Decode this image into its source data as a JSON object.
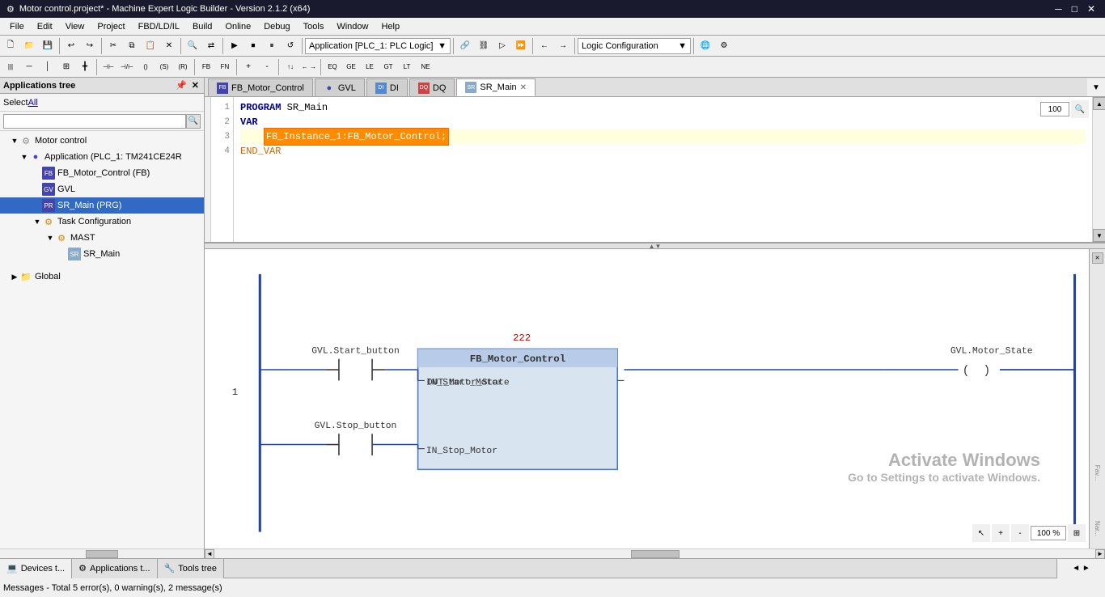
{
  "window": {
    "title": "Motor control.project* - Machine Expert Logic Builder - Version 2.1.2 (x64)"
  },
  "titlebar": {
    "title": "Motor control.project* - Machine Expert Logic Builder - Version 2.1.2 (x64)",
    "minimize": "─",
    "restore": "□",
    "close": "✕"
  },
  "menu": {
    "items": [
      "File",
      "Edit",
      "View",
      "Project",
      "FBD/LD/IL",
      "Build",
      "Online",
      "Debug",
      "Tools",
      "Window",
      "Help"
    ]
  },
  "apps_tree": {
    "header": "Applications tree",
    "select_all": "Select All",
    "tree_items": [
      {
        "label": "Motor control",
        "level": 0,
        "expanded": true,
        "icon": "gear"
      },
      {
        "label": "Application (PLC_1: TM241CE24R",
        "level": 1,
        "expanded": true,
        "icon": "app"
      },
      {
        "label": "FB_Motor_Control (FB)",
        "level": 2,
        "expanded": false,
        "icon": "fb"
      },
      {
        "label": "GVL",
        "level": 2,
        "expanded": false,
        "icon": "gvl"
      },
      {
        "label": "SR_Main (PRG)",
        "level": 2,
        "expanded": false,
        "icon": "prg",
        "selected": true
      },
      {
        "label": "Task Configuration",
        "level": 2,
        "expanded": true,
        "icon": "task"
      },
      {
        "label": "MAST",
        "level": 3,
        "expanded": true,
        "icon": "mast"
      },
      {
        "label": "SR_Main",
        "level": 4,
        "expanded": false,
        "icon": "sr"
      }
    ],
    "global_items": [
      {
        "label": "Global",
        "level": 0,
        "expanded": false,
        "icon": "global"
      }
    ]
  },
  "tabs": [
    {
      "label": "FB_Motor_Control",
      "icon": "fb",
      "active": false,
      "closable": false
    },
    {
      "label": "GVL",
      "icon": "gvl",
      "active": false,
      "closable": false
    },
    {
      "label": "DI",
      "icon": "di",
      "active": false,
      "closable": false
    },
    {
      "label": "DQ",
      "icon": "dq",
      "active": false,
      "closable": false
    },
    {
      "label": "SR_Main",
      "icon": "sr",
      "active": true,
      "closable": true
    }
  ],
  "code": {
    "lines": [
      {
        "num": "1",
        "content": "PROGRAM SR_Main",
        "type": "normal"
      },
      {
        "num": "2",
        "content": "VAR",
        "type": "keyword"
      },
      {
        "num": "3",
        "content": "    FB_Instance_1:FB_Motor_Control;",
        "type": "highlight"
      },
      {
        "num": "4",
        "content": "END_VAR",
        "type": "keyword"
      }
    ],
    "zoom": "100"
  },
  "diagram": {
    "rung_number": "1",
    "error_label": "222",
    "elements": {
      "start_button": {
        "label": "GVL.Start_button",
        "contact_type": "NO"
      },
      "stop_button": {
        "label": "GVL.Stop_button",
        "contact_type": "NO"
      },
      "fb_block": {
        "name": "FB_Motor_Control",
        "input1": "IN_Start_Motor",
        "output1": "OUT_Motor_State",
        "input2": "IN_Stop_Motor"
      },
      "motor_state": {
        "label": "GVL.Motor_State",
        "coil_type": "normal"
      }
    },
    "zoom": "100 %"
  },
  "toolbar_dropdown": {
    "value": "Application [PLC_1: PLC Logic]"
  },
  "toolbar_right_dropdown": {
    "value": "Logic Configuration"
  },
  "bottom": {
    "tabs": [
      {
        "label": "Devices t...",
        "icon": "device"
      },
      {
        "label": "Applications t...",
        "icon": "app"
      },
      {
        "label": "Tools tree",
        "icon": "tools"
      }
    ],
    "message": "Messages - Total 5 error(s), 0 warning(s), 2 message(s)"
  },
  "activation": {
    "line1": "Activate Windows",
    "line2": "Go to Settings to activate Windows."
  }
}
